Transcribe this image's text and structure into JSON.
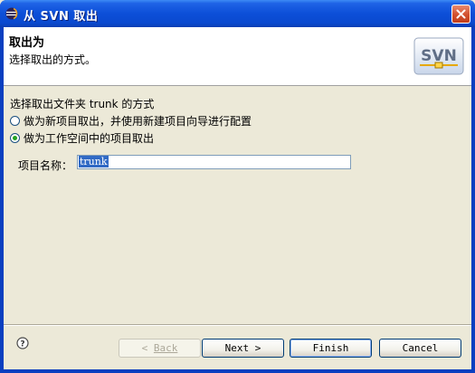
{
  "window": {
    "title": "从 SVN 取出",
    "close_icon": "close-icon"
  },
  "banner": {
    "title": "取出为",
    "description": "选择取出的方式。",
    "logo_text": "SVN"
  },
  "options": {
    "group_label": "选择取出文件夹 trunk 的方式",
    "radio_new_project": "做为新项目取出，并使用新建项目向导进行配置",
    "radio_workspace_project": "做为工作空间中的项目取出",
    "selected": "radio_workspace_project"
  },
  "project": {
    "label": "项目名称：",
    "value": "trunk"
  },
  "buttons": {
    "back_arrow": "< ",
    "back_label": "Back",
    "next_label": "Next >",
    "finish_label": "Finish",
    "cancel_label": "Cancel"
  }
}
